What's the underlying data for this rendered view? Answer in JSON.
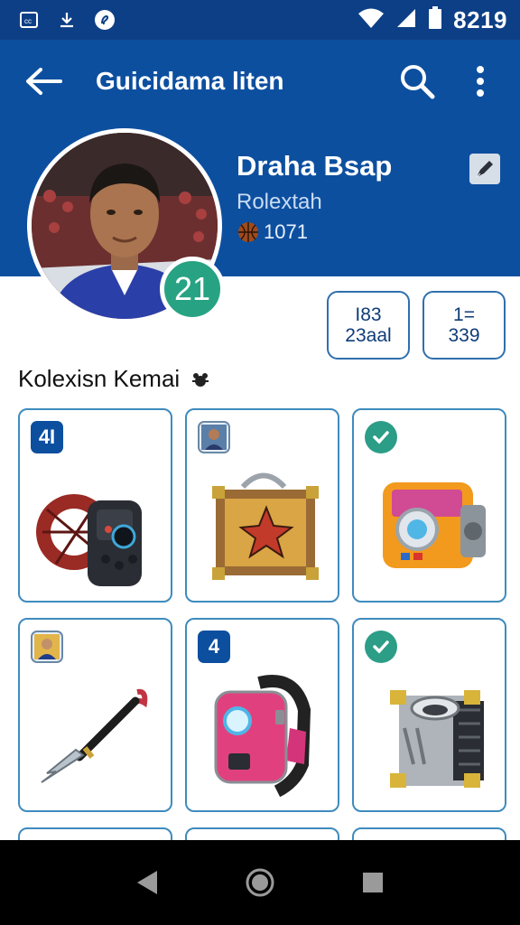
{
  "status_bar": {
    "time": "8219",
    "icons": [
      "cast-icon",
      "download-icon",
      "sync-icon",
      "wifi-icon",
      "signal-icon",
      "battery-icon"
    ]
  },
  "app_bar": {
    "title": "Guicidama liten",
    "back_icon": "arrow-left-icon",
    "search_icon": "search-icon",
    "menu_icon": "more-vert-icon"
  },
  "profile": {
    "name": "Draha Bsap",
    "subtitle": "Rolextah",
    "points": "1071",
    "level": "21",
    "stats": [
      {
        "line1": "I83",
        "line2": "23aal"
      },
      {
        "line1": "1=",
        "line2": "339"
      }
    ]
  },
  "collection": {
    "title": "Kolexisn Kemai",
    "items": [
      {
        "badge_type": "number",
        "badge": "4I",
        "item": "bracelet-controller"
      },
      {
        "badge_type": "avatar",
        "badge": "",
        "item": "treasure-chest"
      },
      {
        "badge_type": "check",
        "badge": "",
        "item": "orange-camera-cube"
      },
      {
        "badge_type": "avatar",
        "badge": "",
        "item": "spear-dagger"
      },
      {
        "badge_type": "number",
        "badge": "4",
        "item": "pink-smartwatch"
      },
      {
        "badge_type": "check",
        "badge": "",
        "item": "metal-gear-cube"
      }
    ]
  },
  "colors": {
    "primary": "#0d4f9f",
    "status": "#0d3f86",
    "accent": "#27a383",
    "tile_border": "#3f8bbe"
  }
}
